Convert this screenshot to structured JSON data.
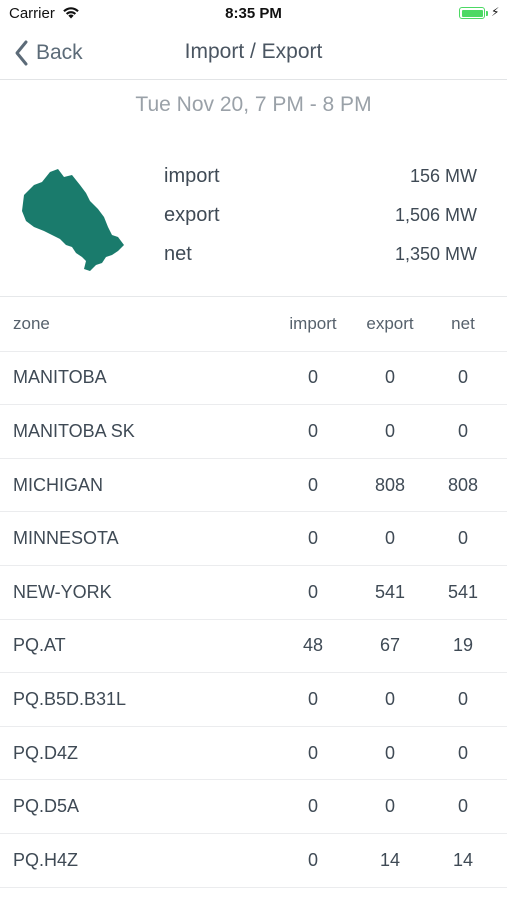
{
  "status_bar": {
    "carrier": "Carrier",
    "time": "8:35 PM"
  },
  "nav": {
    "back_label": "Back",
    "title": "Import / Export"
  },
  "date_range": "Tue Nov 20, 7 PM - 8 PM",
  "summary": [
    {
      "label": "import",
      "value": "156 MW"
    },
    {
      "label": "export",
      "value": "1,506 MW"
    },
    {
      "label": "net",
      "value": "1,350 MW"
    }
  ],
  "table": {
    "headers": [
      "zone",
      "import",
      "export",
      "net"
    ],
    "rows": [
      [
        "MANITOBA",
        "0",
        "0",
        "0"
      ],
      [
        "MANITOBA SK",
        "0",
        "0",
        "0"
      ],
      [
        "MICHIGAN",
        "0",
        "808",
        "808"
      ],
      [
        "MINNESOTA",
        "0",
        "0",
        "0"
      ],
      [
        "NEW-YORK",
        "0",
        "541",
        "541"
      ],
      [
        "PQ.AT",
        "48",
        "67",
        "19"
      ],
      [
        "PQ.B5D.B31L",
        "0",
        "0",
        "0"
      ],
      [
        "PQ.D4Z",
        "0",
        "0",
        "0"
      ],
      [
        "PQ.D5A",
        "0",
        "0",
        "0"
      ],
      [
        "PQ.H4Z",
        "0",
        "14",
        "14"
      ]
    ]
  },
  "colors": {
    "map_fill": "#1a7b6c",
    "battery": "#4cd964"
  }
}
